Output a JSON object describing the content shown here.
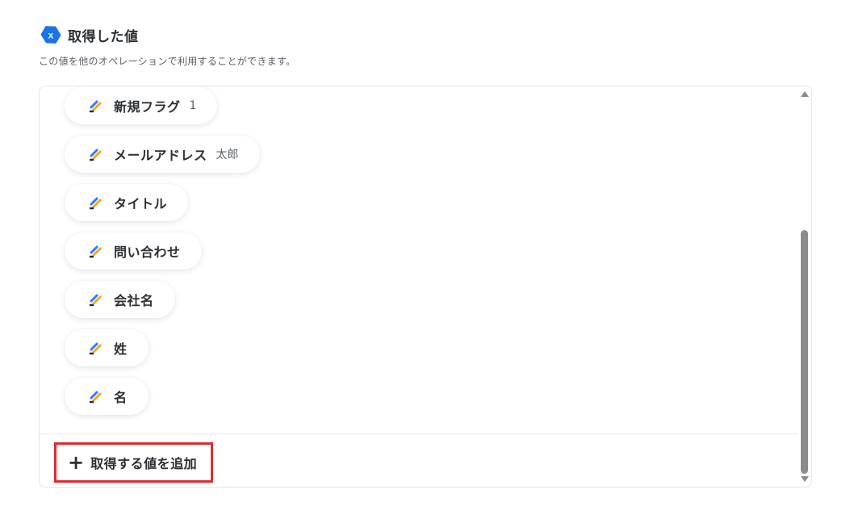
{
  "header": {
    "title": "取得した値",
    "description": "この値を他のオペレーションで利用することができます。",
    "icon": "hex-x-icon",
    "icon_color": "#1a73e8"
  },
  "items": [
    {
      "label": "新規フラグ",
      "value": "1",
      "icon": "pen-icon"
    },
    {
      "label": "メールアドレス",
      "value": "太郎",
      "icon": "pen-icon"
    },
    {
      "label": "タイトル",
      "value": "",
      "icon": "pen-icon"
    },
    {
      "label": "問い合わせ",
      "value": "",
      "icon": "pen-icon"
    },
    {
      "label": "会社名",
      "value": "",
      "icon": "pen-icon"
    },
    {
      "label": "姓",
      "value": "",
      "icon": "pen-icon"
    },
    {
      "label": "名",
      "value": "",
      "icon": "pen-icon"
    }
  ],
  "add_button": {
    "label": "取得する値を追加",
    "icon": "plus-icon",
    "highlight_color": "#e32a2a"
  },
  "colors": {
    "pen_blue": "#2f7bf5",
    "pen_orange": "#f5a623",
    "pen_dark": "#1f2a44"
  }
}
